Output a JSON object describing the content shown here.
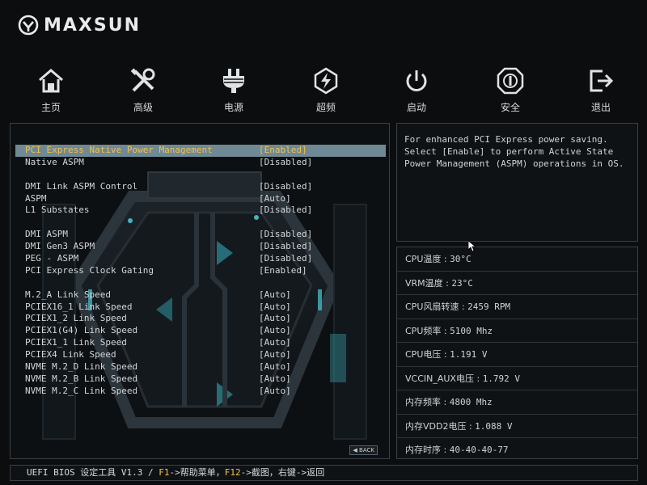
{
  "brand": {
    "name": "MAXSUN"
  },
  "nav": [
    {
      "label": "主页",
      "icon": "home-icon"
    },
    {
      "label": "高级",
      "icon": "tools-icon"
    },
    {
      "label": "电源",
      "icon": "power-plug-icon"
    },
    {
      "label": "超频",
      "icon": "overclock-icon"
    },
    {
      "label": "启动",
      "icon": "boot-power-icon"
    },
    {
      "label": "安全",
      "icon": "security-icon"
    },
    {
      "label": "退出",
      "icon": "exit-icon"
    }
  ],
  "settings": [
    {
      "label": "PCI Express Native Power Management",
      "value": "[Enabled]",
      "selected": true
    },
    {
      "label": "Native ASPM",
      "value": "[Disabled]"
    },
    {
      "label": "DMI Link ASPM Control",
      "value": "[Disabled]"
    },
    {
      "label": "ASPM",
      "value": "[Auto]"
    },
    {
      "label": "L1 Substates",
      "value": "[Disabled]"
    },
    {
      "label": "DMI ASPM",
      "value": "[Disabled]"
    },
    {
      "label": "DMI Gen3 ASPM",
      "value": "[Disabled]"
    },
    {
      "label": "PEG - ASPM",
      "value": "[Disabled]"
    },
    {
      "label": "PCI Express Clock Gating",
      "value": "[Enabled]"
    },
    {
      "label": "M.2_A Link Speed",
      "value": "[Auto]"
    },
    {
      "label": "PCIEX16_1 Link Speed",
      "value": "[Auto]"
    },
    {
      "label": "PCIEX1_2 Link Speed",
      "value": "[Auto]"
    },
    {
      "label": "PCIEX1(G4) Link Speed",
      "value": "[Auto]"
    },
    {
      "label": "PCIEX1_1 Link Speed",
      "value": "[Auto]"
    },
    {
      "label": "PCIEX4 Link Speed",
      "value": "[Auto]"
    },
    {
      "label": "NVME M.2_D Link Speed",
      "value": "[Auto]"
    },
    {
      "label": "NVME M.2_B Link Speed",
      "value": "[Auto]"
    },
    {
      "label": "NVME M.2_C Link Speed",
      "value": "[Auto]"
    }
  ],
  "back_label": "BACK",
  "help": "For enhanced PCI Express power saving.\nSelect [Enable] to perform Active State\nPower Management (ASPM) operations in OS.",
  "status": [
    {
      "label": "CPU温度",
      "value": "30°C"
    },
    {
      "label": "VRM温度",
      "value": "23°C"
    },
    {
      "label": "CPU风扇转速",
      "value": "2459 RPM"
    },
    {
      "label": "CPU频率",
      "value": "5100 Mhz"
    },
    {
      "label": "CPU电压",
      "value": "1.191 V"
    },
    {
      "label": "VCCIN_AUX电压",
      "value": "1.792 V"
    },
    {
      "label": "内存频率",
      "value": "4800 Mhz"
    },
    {
      "label": "内存VDD2电压",
      "value": "1.088 V"
    },
    {
      "label": "内存时序",
      "value": "40-40-40-77"
    }
  ],
  "status_separator": " : ",
  "footer": {
    "title": "UEFI BIOS 设定工具 V1.3 / ",
    "f1_key": "F1",
    "f1_text": "->帮助菜单，",
    "f12_key": "F12",
    "f12_text": "->截图，右键->返回"
  },
  "colors": {
    "accent_yellow": "#f0c050",
    "selection_bg": "#6f8995",
    "panel_border": "#3a4046",
    "background": "#0b0d0f"
  }
}
